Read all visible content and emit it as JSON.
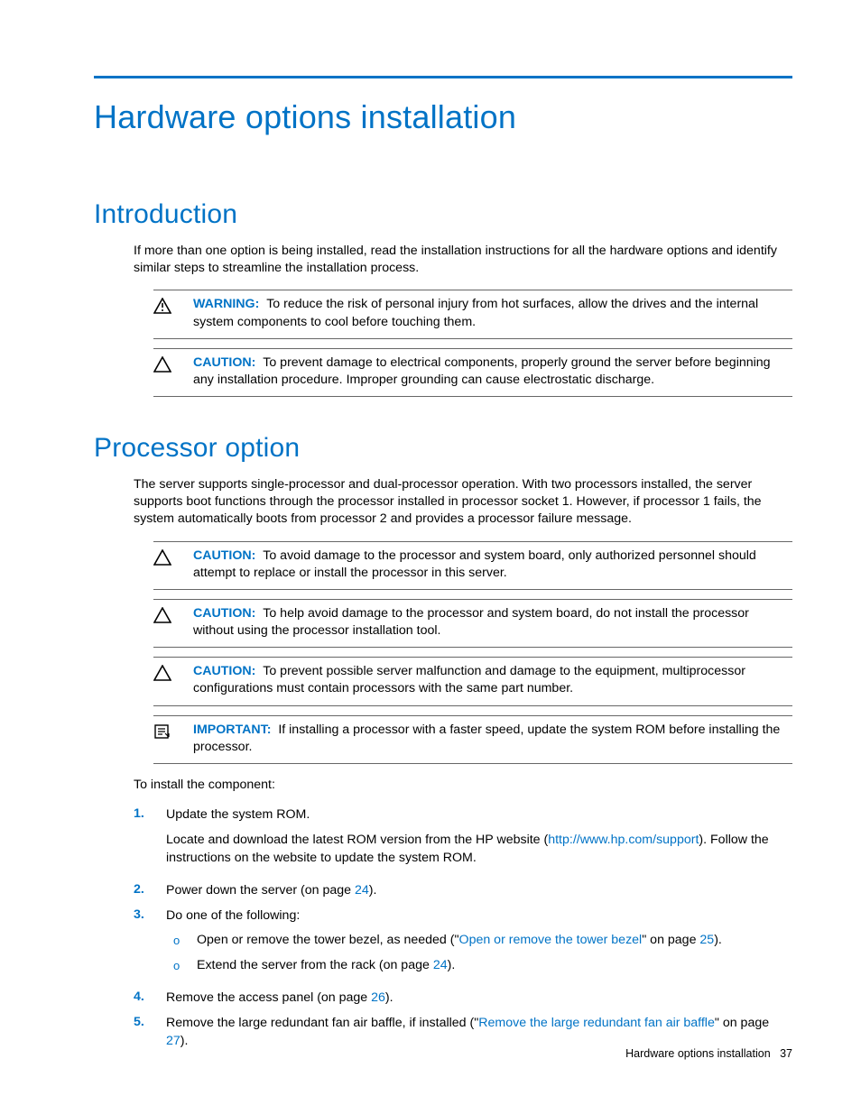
{
  "title": "Hardware options installation",
  "intro": {
    "heading": "Introduction",
    "paragraph": "If more than one option is being installed, read the installation instructions for all the hardware options and identify similar steps to streamline the installation process.",
    "notices": [
      {
        "icon": "warning-bang",
        "label": "WARNING:",
        "text": "To reduce the risk of personal injury from hot surfaces, allow the drives and the internal system components to cool before touching them."
      },
      {
        "icon": "caution",
        "label": "CAUTION:",
        "text": "To prevent damage to electrical components, properly ground the server before beginning any installation procedure. Improper grounding can cause electrostatic discharge."
      }
    ]
  },
  "processor": {
    "heading": "Processor option",
    "paragraph": "The server supports single-processor and dual-processor operation. With two processors installed, the server supports boot functions through the processor installed in processor socket 1. However, if processor 1 fails, the system automatically boots from processor 2 and provides a processor failure message.",
    "notices": [
      {
        "icon": "caution",
        "label": "CAUTION:",
        "text": "To avoid damage to the processor and system board, only authorized personnel should attempt to replace or install the processor in this server."
      },
      {
        "icon": "caution",
        "label": "CAUTION:",
        "text": "To help avoid damage to the processor and system board, do not install the processor without using the processor installation tool."
      },
      {
        "icon": "caution",
        "label": "CAUTION:",
        "text": "To prevent possible server malfunction and damage to the equipment, multiprocessor configurations must contain processors with the same part number."
      },
      {
        "icon": "important",
        "label": "IMPORTANT:",
        "text": "If installing a processor with a faster speed, update the system ROM before installing the processor."
      }
    ],
    "install_lead": "To install the component:",
    "steps": {
      "s1_a": "Update the system ROM.",
      "s1_b_pre": "Locate and download the latest ROM version from the HP website (",
      "s1_b_link": "http://www.hp.com/support",
      "s1_b_post": "). Follow the instructions on the website to update the system ROM.",
      "s2_pre": "Power down the server (on page ",
      "s2_link": "24",
      "s2_post": ").",
      "s3": "Do one of the following:",
      "s3a_pre": "Open or remove the tower bezel, as needed (\"",
      "s3a_link": "Open or remove the tower bezel",
      "s3a_mid": "\" on page ",
      "s3a_page": "25",
      "s3a_post": ").",
      "s3b_pre": "Extend the server from the rack (on page ",
      "s3b_link": "24",
      "s3b_post": ").",
      "s4_pre": "Remove the access panel (on page ",
      "s4_link": "26",
      "s4_post": ").",
      "s5_pre": "Remove the large redundant fan air baffle, if installed (\"",
      "s5_link": "Remove the large redundant fan air baffle",
      "s5_mid": "\" on page ",
      "s5_page": "27",
      "s5_post": ")."
    },
    "step_numbers": [
      "1.",
      "2.",
      "3.",
      "4.",
      "5."
    ],
    "sub_bullet": "o"
  },
  "footer": {
    "text": "Hardware options installation",
    "page": "37"
  }
}
